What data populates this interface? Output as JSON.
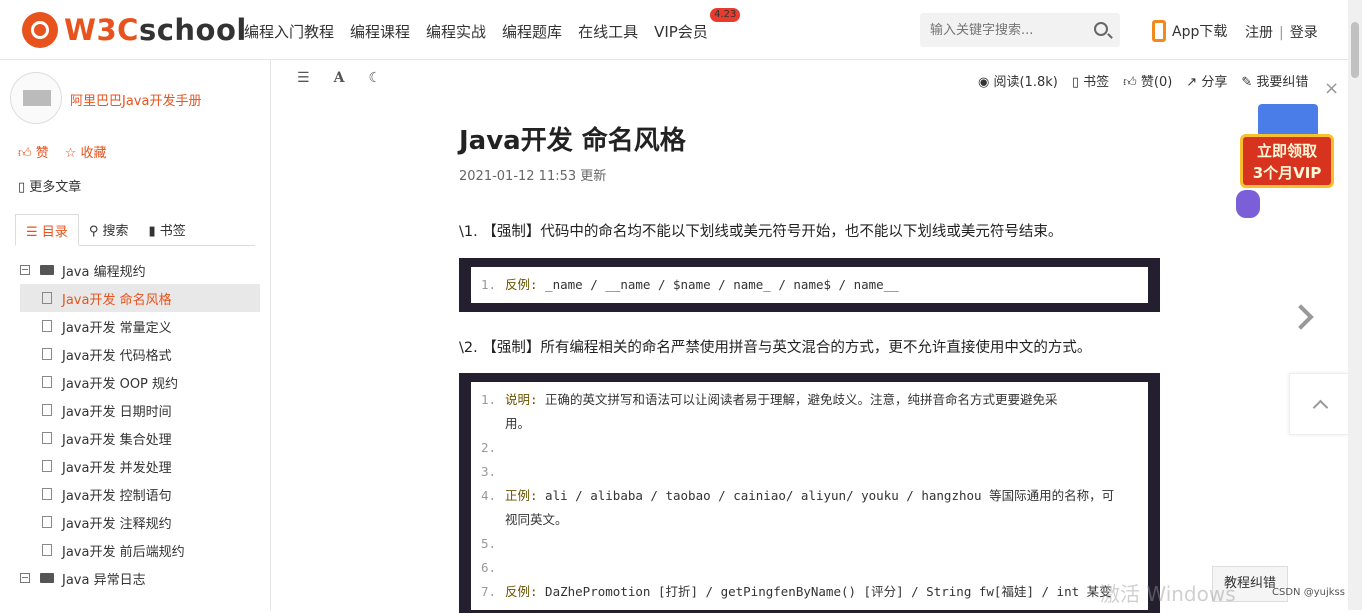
{
  "header": {
    "logo_prefix": "W3C",
    "logo_suffix": "school",
    "nav": [
      "编程入门教程",
      "编程课程",
      "编程实战",
      "编程题库",
      "在线工具",
      "VIP会员"
    ],
    "vip_badge": "4.23",
    "search_placeholder": "输入关键字搜索...",
    "app_download": "App下载",
    "register": "注册",
    "sep": "|",
    "login": "登录"
  },
  "sidebar": {
    "book_title": "阿里巴巴Java开发手册",
    "like": "赞",
    "collect": "收藏",
    "more": "更多文章",
    "tabs": [
      "目录",
      "搜索",
      "书签"
    ],
    "toc": [
      {
        "label": "Java 编程规约",
        "type": "folder"
      },
      {
        "label": "Java开发 命名风格",
        "type": "child",
        "selected": true
      },
      {
        "label": "Java开发 常量定义",
        "type": "child"
      },
      {
        "label": "Java开发 代码格式",
        "type": "child"
      },
      {
        "label": "Java开发 OOP 规约",
        "type": "child"
      },
      {
        "label": "Java开发 日期时间",
        "type": "child"
      },
      {
        "label": "Java开发 集合处理",
        "type": "child"
      },
      {
        "label": "Java开发 并发处理",
        "type": "child"
      },
      {
        "label": "Java开发 控制语句",
        "type": "child"
      },
      {
        "label": "Java开发 注释规约",
        "type": "child"
      },
      {
        "label": "Java开发 前后端规约",
        "type": "child"
      },
      {
        "label": "Java 异常日志",
        "type": "folder"
      }
    ]
  },
  "toolbar": {
    "list_icon": "☰",
    "font_icon": "A",
    "night_icon": "☾",
    "read": "阅读(1.8k)",
    "bookmark": "书签",
    "like": "赞(0)",
    "share": "分享",
    "report": "我要纠错"
  },
  "article": {
    "title": "Java开发 命名风格",
    "date": "2021-01-12 11:53 更新",
    "p1": "\\1. 【强制】代码中的命名均不能以下划线或美元符号开始，也不能以下划线或美元符号结束。",
    "code1": [
      {
        "n": "1.",
        "label": "反例:",
        "text": " _name / __name / $name / name_ / name$ / name__"
      }
    ],
    "p2": "\\2. 【强制】所有编程相关的命名严禁使用拼音与英文混合的方式，更不允许直接使用中文的方式。",
    "code2": [
      {
        "n": "1.",
        "label": "说明:",
        "text": " 正确的英文拼写和语法可以让阅读者易于理解，避免歧义。注意，纯拼音命名方式更要避免采"
      },
      {
        "n": "",
        "label": "",
        "text": "用。"
      },
      {
        "n": "2.",
        "label": "",
        "text": ""
      },
      {
        "n": "3.",
        "label": "",
        "text": ""
      },
      {
        "n": "4.",
        "label": "正例:",
        "text": " ali / alibaba / taobao / cainiao/ aliyun/ youku / hangzhou 等国际通用的名称，可"
      },
      {
        "n": "",
        "label": "",
        "text": "视同英文。"
      },
      {
        "n": "5.",
        "label": "",
        "text": ""
      },
      {
        "n": "6.",
        "label": "",
        "text": ""
      },
      {
        "n": "7.",
        "label": "反例:",
        "text": " DaZhePromotion [打折] / getPingfenByName() [评分] / String fw[福娃] / int 某变"
      }
    ]
  },
  "promo": {
    "line1": "立即领取",
    "line2": "3个月VIP",
    "close": "×"
  },
  "float": {
    "fix_button": "教程纠错",
    "watermark": "激活 Windows",
    "csdn": "CSDN @yujkss"
  }
}
